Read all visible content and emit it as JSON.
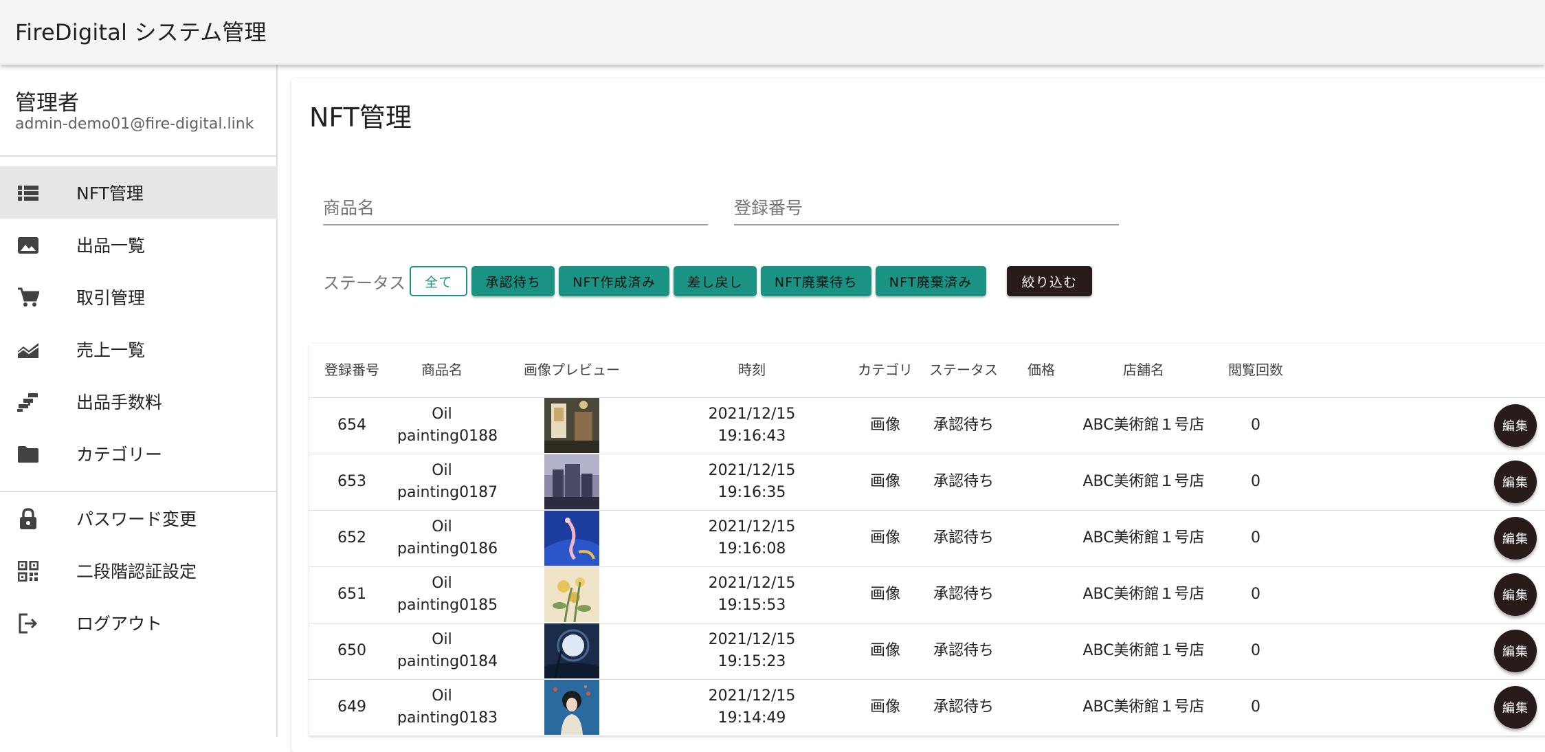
{
  "app": {
    "title": "FireDigital システム管理"
  },
  "user": {
    "name": "管理者",
    "email": "admin-demo01@fire-digital.link"
  },
  "nav": {
    "items": [
      {
        "label": "NFT管理",
        "icon": "list-icon",
        "active": true
      },
      {
        "label": "出品一覧",
        "icon": "image-icon",
        "active": false
      },
      {
        "label": "取引管理",
        "icon": "cart-icon",
        "active": false
      },
      {
        "label": "売上一覧",
        "icon": "area-chart-icon",
        "active": false
      },
      {
        "label": "出品手数料",
        "icon": "stairs-icon",
        "active": false
      },
      {
        "label": "カテゴリー",
        "icon": "folder-icon",
        "active": false
      }
    ],
    "secondary": [
      {
        "label": "パスワード変更",
        "icon": "lock-icon"
      },
      {
        "label": "二段階認証設定",
        "icon": "qr-code-icon"
      },
      {
        "label": "ログアウト",
        "icon": "logout-icon"
      }
    ]
  },
  "page": {
    "title": "NFT管理"
  },
  "filters": {
    "product_name_placeholder": "商品名",
    "reg_number_placeholder": "登録番号",
    "status_label": "ステータス",
    "status_chips": [
      "全て",
      "承認待ち",
      "NFT作成済み",
      "差し戻し",
      "NFT廃棄待ち",
      "NFT廃棄済み"
    ],
    "selected_status": "全て",
    "apply_label": "絞り込む"
  },
  "table": {
    "headers": [
      "登録番号",
      "商品名",
      "画像プレビュー",
      "時刻",
      "カテゴリ",
      "ステータス",
      "価格",
      "店舗名",
      "閲覧回数",
      ""
    ],
    "edit_label": "編集",
    "rows": [
      {
        "id": "654",
        "name": "Oil painting0188",
        "date": "2021/12/15",
        "time": "19:16:43",
        "category": "画像",
        "status": "承認待ち",
        "price": "",
        "store": "ABC美術館１号店",
        "views": "0"
      },
      {
        "id": "653",
        "name": "Oil painting0187",
        "date": "2021/12/15",
        "time": "19:16:35",
        "category": "画像",
        "status": "承認待ち",
        "price": "",
        "store": "ABC美術館１号店",
        "views": "0"
      },
      {
        "id": "652",
        "name": "Oil painting0186",
        "date": "2021/12/15",
        "time": "19:16:08",
        "category": "画像",
        "status": "承認待ち",
        "price": "",
        "store": "ABC美術館１号店",
        "views": "0"
      },
      {
        "id": "651",
        "name": "Oil painting0185",
        "date": "2021/12/15",
        "time": "19:15:53",
        "category": "画像",
        "status": "承認待ち",
        "price": "",
        "store": "ABC美術館１号店",
        "views": "0"
      },
      {
        "id": "650",
        "name": "Oil painting0184",
        "date": "2021/12/15",
        "time": "19:15:23",
        "category": "画像",
        "status": "承認待ち",
        "price": "",
        "store": "ABC美術館１号店",
        "views": "0"
      },
      {
        "id": "649",
        "name": "Oil painting0183",
        "date": "2021/12/15",
        "time": "19:14:49",
        "category": "画像",
        "status": "承認待ち",
        "price": "",
        "store": "ABC美術館１号店",
        "views": "0"
      }
    ]
  },
  "colors": {
    "accent": "#1a9384",
    "dark_button": "#2a1b1b",
    "active_nav": "#e6e6e6"
  }
}
